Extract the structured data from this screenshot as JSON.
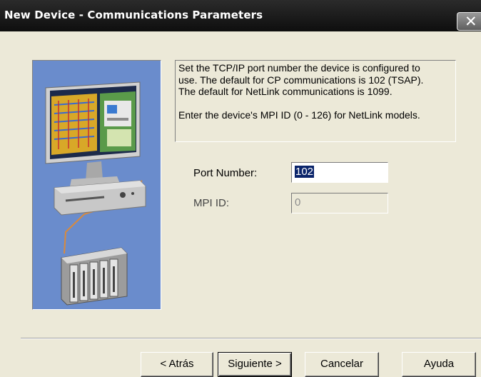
{
  "window": {
    "title": "New Device - Communications Parameters",
    "close_glyph": "✕"
  },
  "illustration": {
    "icon": "computer-network-plc-illustration",
    "background_color": "#6a8ccc"
  },
  "description": {
    "paragraph1_lines": [
      "Set the TCP/IP port number the device is configured to",
      "use.  The default for CP communications is 102 (TSAP).",
      "The default for NetLink communications is 1099."
    ],
    "paragraph2": "Enter the device's MPI ID (0 - 126) for NetLink models."
  },
  "fields": {
    "port_number": {
      "label": "Port Number:",
      "value": "102"
    },
    "mpi_id": {
      "label": "MPI ID:",
      "value": "0",
      "disabled": true
    }
  },
  "buttons": {
    "back": "< Atrás",
    "next": "Siguiente >",
    "cancel": "Cancelar",
    "help": "Ayuda"
  }
}
